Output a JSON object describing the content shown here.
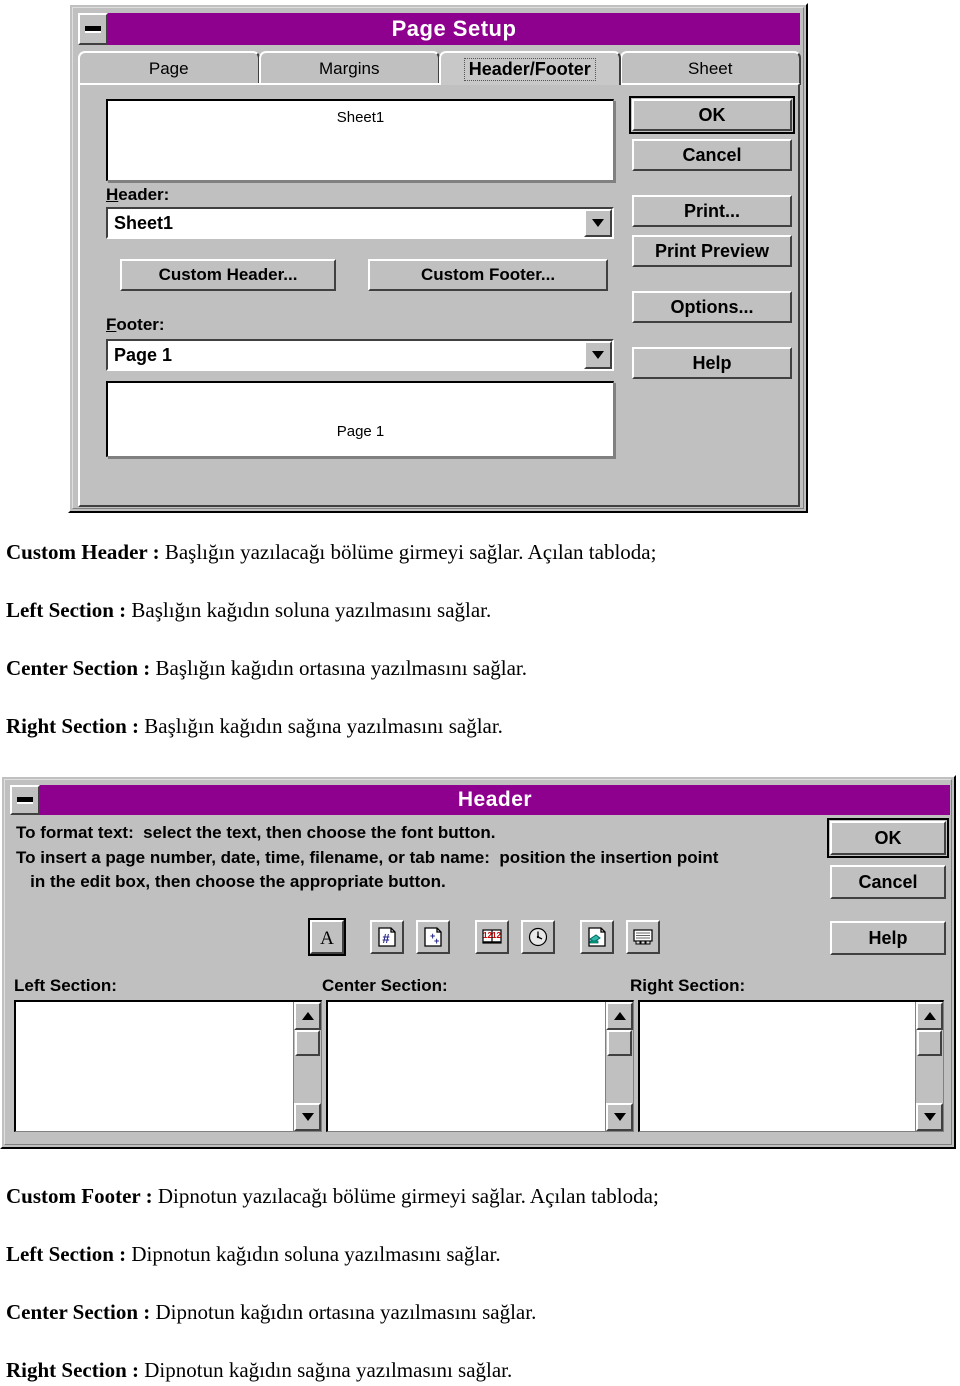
{
  "page_setup_dialog": {
    "title": "Page Setup",
    "minimize_icon": "minimize-icon",
    "tabs": [
      {
        "label": "Page",
        "selected": false
      },
      {
        "label": "Margins",
        "selected": false
      },
      {
        "label": "Header/Footer",
        "selected": true
      },
      {
        "label": "Sheet",
        "selected": false
      }
    ],
    "header_preview_text": "Sheet1",
    "footer_preview_text": "Page 1",
    "header_label": "Header:",
    "header_value": "Sheet1",
    "footer_label": "Footer:",
    "footer_value": "Page 1",
    "custom_header_button": "Custom Header...",
    "custom_footer_button": "Custom Footer...",
    "side_buttons": [
      {
        "label": "OK",
        "default": true
      },
      {
        "label": "Cancel",
        "default": false
      },
      {
        "label": "Print...",
        "default": false
      },
      {
        "label": "Print Preview",
        "default": false
      },
      {
        "label": "Options...",
        "default": false
      },
      {
        "label": "Help",
        "default": false
      }
    ]
  },
  "body_text_top": [
    {
      "bold": "Custom Header :",
      "rest": " Başlığın yazılacağı bölüme girmeyi sağlar. Açılan tabloda;"
    },
    {
      "bold": "Left Section :",
      "rest": " Başlığın kağıdın soluna yazılmasını sağlar."
    },
    {
      "bold": "Center Section :",
      "rest": " Başlığın kağıdın ortasına yazılmasını sağlar."
    },
    {
      "bold": "Right Section :",
      "rest": " Başlığın kağıdın sağına yazılmasını sağlar."
    }
  ],
  "header_dialog": {
    "title": "Header",
    "minimize_icon": "minimize-icon",
    "instructions": [
      "To format text:  select the text, then choose the font button.",
      "To insert a page number, date, time, filename, or tab name:  position the insertion point",
      "   in the edit box, then choose the appropriate button."
    ],
    "toolbar": [
      {
        "icon": "font-format-icon",
        "name": "font-button",
        "default": true
      },
      {
        "icon": "page-number-icon",
        "name": "page-number-button",
        "default": false
      },
      {
        "icon": "total-pages-icon",
        "name": "total-pages-button",
        "default": false
      },
      {
        "icon": "date-calendar-icon",
        "name": "date-button",
        "default": false
      },
      {
        "icon": "clock-time-icon",
        "name": "time-button",
        "default": false
      },
      {
        "icon": "filename-icon",
        "name": "filename-button",
        "default": false
      },
      {
        "icon": "tab-name-icon",
        "name": "tab-name-button",
        "default": false
      }
    ],
    "sections": [
      {
        "label": "Left Section:",
        "value": ""
      },
      {
        "label": "Center Section:",
        "value": ""
      },
      {
        "label": "Right Section:",
        "value": ""
      }
    ],
    "buttons": [
      {
        "label": "OK",
        "default": true
      },
      {
        "label": "Cancel",
        "default": false
      },
      {
        "label": "Help",
        "default": false
      }
    ]
  },
  "body_text_bottom": [
    {
      "bold": "Custom Footer :",
      "rest": " Dipnotun yazılacağı bölüme girmeyi sağlar. Açılan tabloda;"
    },
    {
      "bold": "Left Section :",
      "rest": " Dipnotun kağıdın soluna yazılmasını sağlar."
    },
    {
      "bold": "Center Section :",
      "rest": " Dipnotun kağıdın ortasına yazılmasını sağlar."
    },
    {
      "bold": "Right Section :",
      "rest": " Dipnotun kağıdın sağına yazılmasını sağlar."
    }
  ],
  "colors": {
    "titlebar": "#8e008e",
    "face": "#c0c0c0",
    "shadow": "#404040",
    "highlight": "#ffffff",
    "text": "#000000"
  }
}
